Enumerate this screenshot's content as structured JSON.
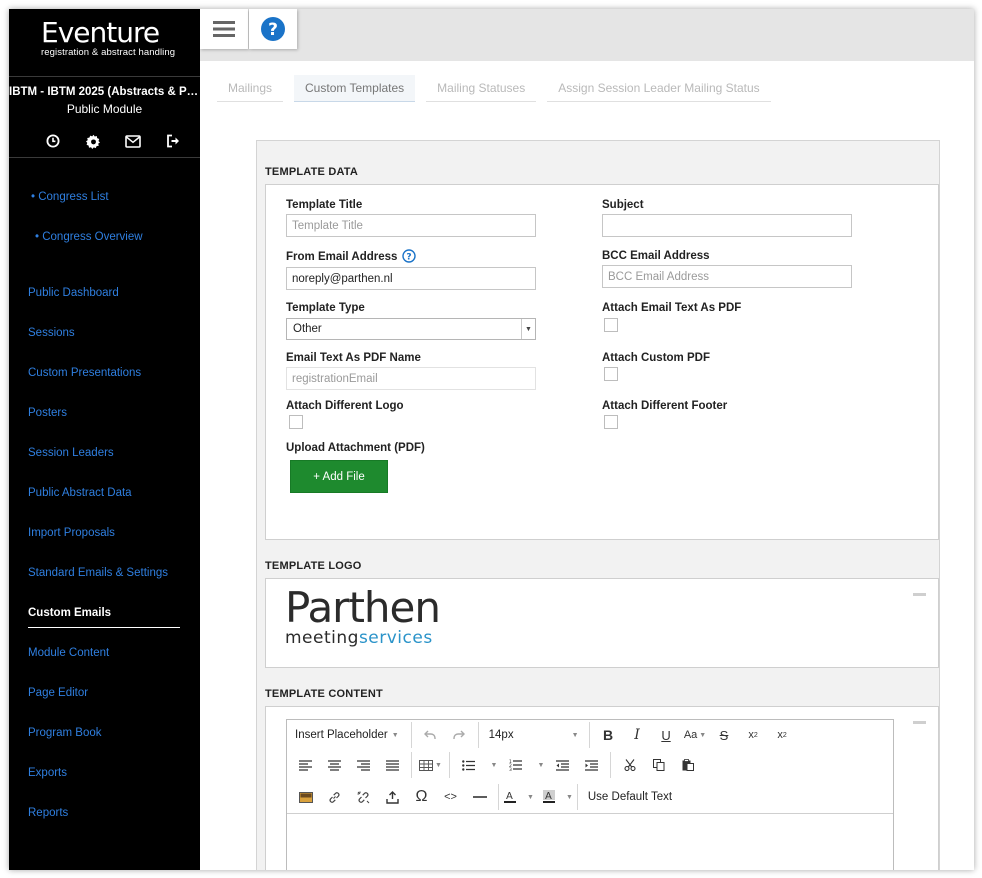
{
  "app": {
    "logo_main": "Eventure",
    "logo_sub": "registration & abstract handling",
    "congress_name": "IBTM - IBTM 2025 (Abstracts & Par...",
    "module_name": "Public Module"
  },
  "sidebar_icons": [
    "clock-icon",
    "gear-icon",
    "envelope-icon",
    "logout-icon"
  ],
  "nav": {
    "congress_list": "• Congress List",
    "congress_overview": "• Congress Overview",
    "items": [
      "Public Dashboard",
      "Sessions",
      "Custom Presentations",
      "Posters",
      "Session Leaders",
      "Public Abstract Data",
      "Import Proposals",
      "Standard Emails & Settings",
      "Custom Emails",
      "Module Content",
      "Page Editor",
      "Program Book",
      "Exports",
      "Reports"
    ],
    "active": "Custom Emails"
  },
  "tabs": [
    "Mailings",
    "Custom Templates",
    "Mailing Statuses",
    "Assign Session Leader Mailing Status"
  ],
  "active_tab": "Custom Templates",
  "template_data": {
    "section_title": "TEMPLATE DATA",
    "template_title_label": "Template Title",
    "template_title_placeholder": "Template Title",
    "subject_label": "Subject",
    "subject_value": "",
    "from_email_label": "From Email Address",
    "from_email_value": "noreply@parthen.nl",
    "bcc_label": "BCC Email Address",
    "bcc_placeholder": "BCC Email Address",
    "template_type_label": "Template Type",
    "template_type_value": "Other",
    "attach_pdf_label": "Attach Email Text As PDF",
    "pdf_name_label": "Email Text As PDF Name",
    "pdf_name_placeholder": "registrationEmail",
    "attach_custom_pdf_label": "Attach Custom PDF",
    "attach_logo_label": "Attach Different Logo",
    "attach_footer_label": "Attach Different Footer",
    "upload_label": "Upload Attachment (PDF)",
    "add_file_label": "+ Add File"
  },
  "template_logo": {
    "section_title": "TEMPLATE LOGO",
    "logo_word": "Parthen",
    "logo_meeting": "meeting",
    "logo_services": "services"
  },
  "template_content": {
    "section_title": "TEMPLATE CONTENT",
    "insert_placeholder": "Insert Placeholder",
    "font_size": "14px",
    "font_case": "Aa",
    "use_default_text": "Use Default Text"
  },
  "colors": {
    "nav_link": "#2f7fe0",
    "add_button": "#1e8a2e",
    "help_icon": "#1a73c8",
    "logo_blue": "#2a93c9"
  }
}
